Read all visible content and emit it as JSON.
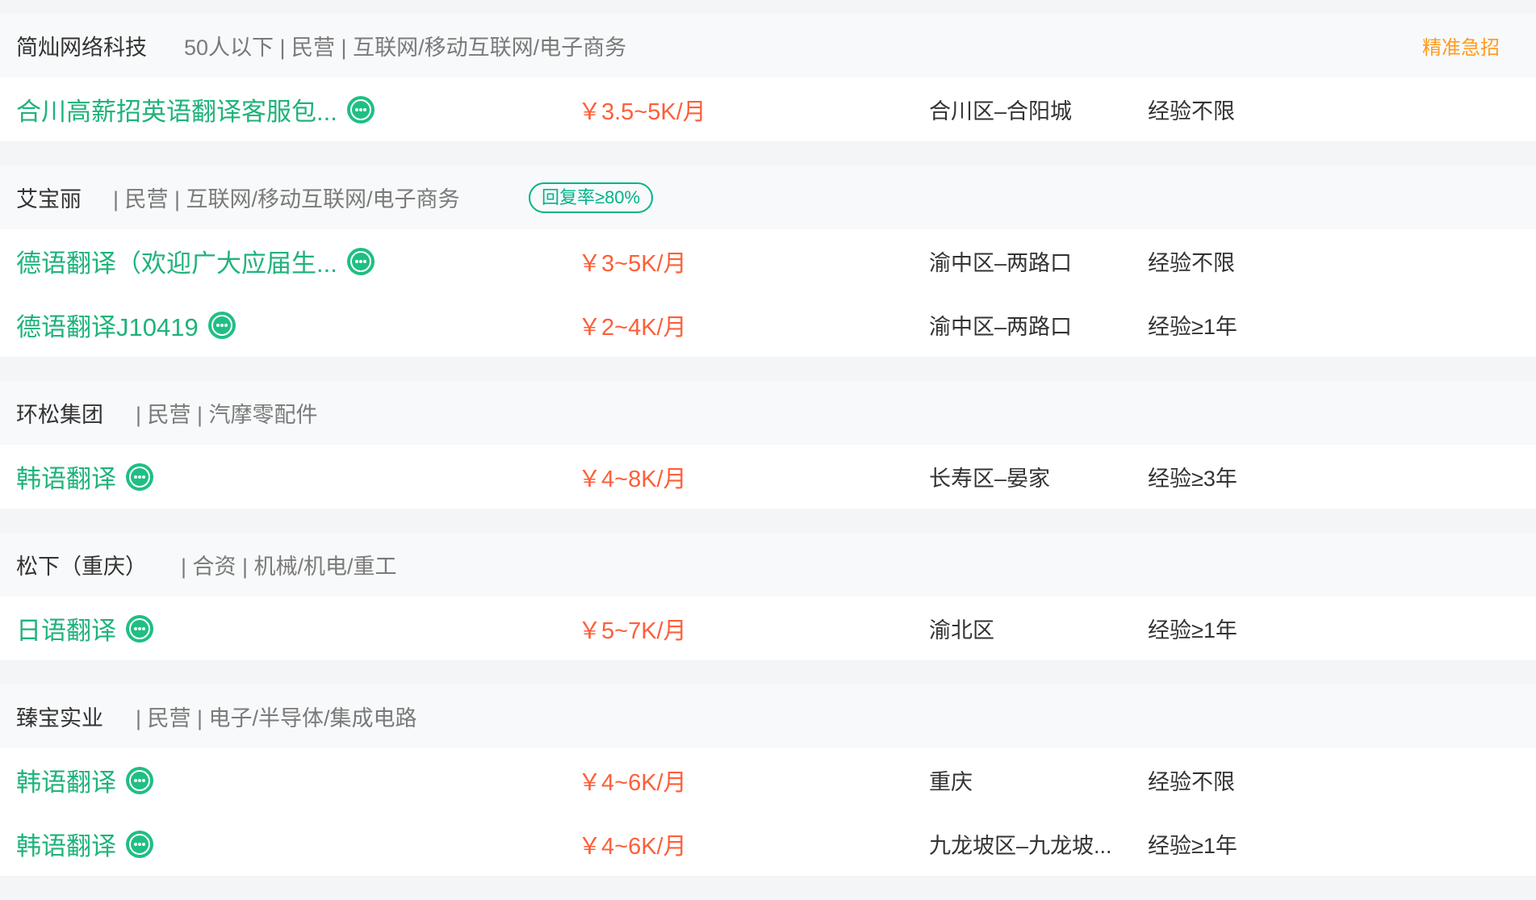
{
  "colors": {
    "job_title": "#1fb37a",
    "salary": "#fd5f39",
    "badge": "#00b38a",
    "urgent_tag": "#ff9a1f"
  },
  "groups": [
    {
      "company": "简灿网络科技",
      "meta": "50人以下 | 民营 | 互联网/移动互联网/电子商务",
      "tag": "精准急招",
      "jobs": [
        {
          "title": "合川高薪招英语翻译客服包...",
          "salary": "￥3.5~5K/月",
          "location": "合川区–合阳城",
          "experience": "经验不限",
          "icon": "chat-icon"
        }
      ]
    },
    {
      "company": "艾宝丽",
      "meta": "| 民营 | 互联网/移动互联网/电子商务",
      "badge": "回复率≥80%",
      "jobs": [
        {
          "title": "德语翻译（欢迎广大应届生...",
          "salary": "￥3~5K/月",
          "location": "渝中区–两路口",
          "experience": "经验不限",
          "icon": "chat-icon"
        },
        {
          "title": "德语翻译J10419",
          "salary": "￥2~4K/月",
          "location": "渝中区–两路口",
          "experience": "经验≥1年",
          "icon": "chat-icon"
        }
      ]
    },
    {
      "company": "环松集团",
      "meta": "| 民营 | 汽摩零配件",
      "jobs": [
        {
          "title": "韩语翻译",
          "salary": "￥4~8K/月",
          "location": "长寿区–晏家",
          "experience": "经验≥3年",
          "icon": "chat-icon"
        }
      ]
    },
    {
      "company": "松下（重庆）",
      "meta": "| 合资 | 机械/机电/重工",
      "jobs": [
        {
          "title": "日语翻译",
          "salary": "￥5~7K/月",
          "location": "渝北区",
          "experience": "经验≥1年",
          "icon": "chat-icon"
        }
      ]
    },
    {
      "company": "臻宝实业",
      "meta": "| 民营 | 电子/半导体/集成电路",
      "jobs": [
        {
          "title": "韩语翻译",
          "salary": "￥4~6K/月",
          "location": "重庆",
          "experience": "经验不限",
          "icon": "chat-icon"
        },
        {
          "title": "韩语翻译",
          "salary": "￥4~6K/月",
          "location": "九龙坡区–九龙坡...",
          "experience": "经验≥1年",
          "icon": "chat-icon"
        }
      ]
    }
  ]
}
